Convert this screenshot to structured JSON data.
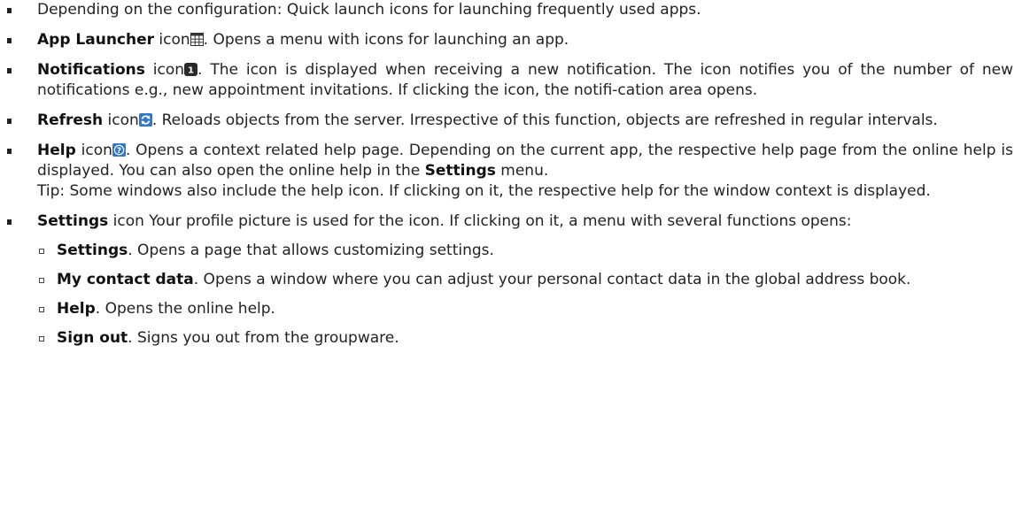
{
  "items": [
    {
      "text": "Depending on the configuration: Quick launch icons for launching frequently used apps."
    },
    {
      "bold": "App Launcher",
      "pre": " icon",
      "icon": "grid-icon",
      "post": ". Opens a menu with icons for launching an app."
    },
    {
      "bold": "Notifications",
      "pre": " icon",
      "icon": "notification-badge-icon",
      "icon_text": "1",
      "post": ". The icon is displayed when receiving a new notification. The icon notifies you of the number of new notifications e.g., new appointment invitations. If clicking the icon, the notifi-cation area opens."
    },
    {
      "bold": "Refresh",
      "pre": " icon",
      "icon": "refresh-icon",
      "post": ". Reloads objects from the server. Irrespective of this function, objects are refreshed in regular intervals."
    },
    {
      "bold": "Help",
      "pre": " icon",
      "icon": "help-icon",
      "icon_text": "?",
      "post_a": ". Opens a context related help page. Depending on the current app, the respective help page from the online help is displayed. You can also open the online help in the ",
      "post_bold": "Settings",
      "post_b": " menu.",
      "tip": "Tip: Some windows also include the help icon. If clicking on it, the respective help for the window context is displayed."
    },
    {
      "bold": "Settings",
      "post": " icon Your profile picture is used for the icon. If clicking on it, a menu with several functions opens:",
      "subitems": [
        {
          "bold": "Settings",
          "post": ". Opens a page that allows customizing settings."
        },
        {
          "bold": "My contact data",
          "post": ". Opens a window where you can adjust your personal contact data in the global address book."
        },
        {
          "bold": "Help",
          "post": ". Opens the online help."
        },
        {
          "bold": "Sign out",
          "post": ". Signs you out from the groupware."
        }
      ]
    }
  ],
  "colors": {
    "text": "#222222",
    "icon_dark": "#333333",
    "icon_blue": "#2e78c7"
  }
}
